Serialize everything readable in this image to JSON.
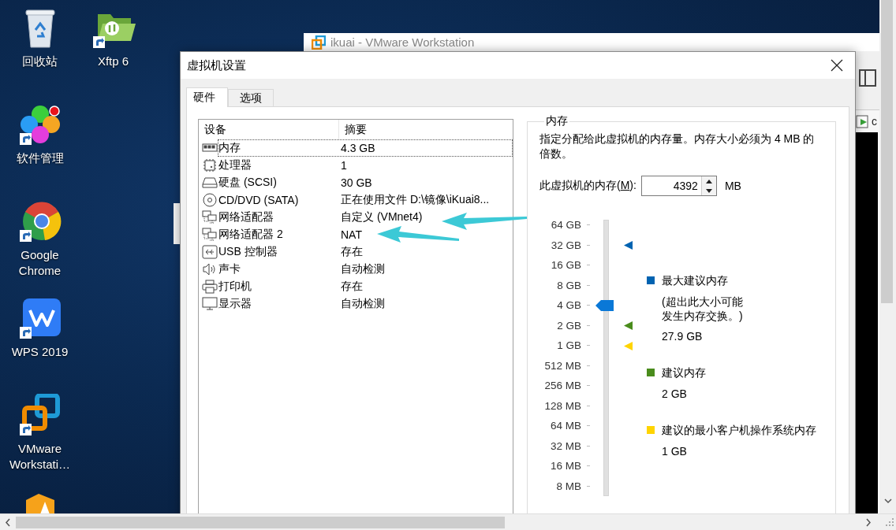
{
  "desktop_icons": [
    {
      "kind": "recycle-bin",
      "label": "回收站"
    },
    {
      "kind": "folder-app",
      "label": "Xftp 6"
    },
    {
      "kind": "flower-app",
      "label": "软件管理"
    },
    {
      "kind": "browser",
      "label": "Google Chrome"
    },
    {
      "kind": "office",
      "label": "WPS 2019"
    },
    {
      "kind": "vm",
      "label": "VMware Workstati…"
    },
    {
      "kind": "partial-app"
    }
  ],
  "background_window": {
    "title": "ikuai - VMware Workstation",
    "tab_label": "c"
  },
  "dialog": {
    "title": "虚拟机设置",
    "tabs": [
      {
        "label": "硬件",
        "selected": true
      },
      {
        "label": "选项",
        "selected": false
      }
    ],
    "device_list": {
      "columns": [
        "设备",
        "摘要"
      ],
      "rows": [
        {
          "kind": "memory",
          "device": "内存",
          "summary": "4.3 GB",
          "selected": true
        },
        {
          "kind": "cpu",
          "device": "处理器",
          "summary": "1",
          "selected": false
        },
        {
          "kind": "disk",
          "device": "硬盘 (SCSI)",
          "summary": "30 GB",
          "selected": false
        },
        {
          "kind": "cdrom",
          "device": "CD/DVD (SATA)",
          "summary": "正在使用文件 D:\\镜像\\iKuai8...",
          "selected": false
        },
        {
          "kind": "network",
          "device": "网络适配器",
          "summary": "自定义 (VMnet4)",
          "selected": false
        },
        {
          "kind": "network",
          "device": "网络适配器 2",
          "summary": "NAT",
          "selected": false
        },
        {
          "kind": "usb",
          "device": "USB 控制器",
          "summary": "存在",
          "selected": false
        },
        {
          "kind": "sound",
          "device": "声卡",
          "summary": "自动检测",
          "selected": false
        },
        {
          "kind": "printer",
          "device": "打印机",
          "summary": "存在",
          "selected": false
        },
        {
          "kind": "display",
          "device": "显示器",
          "summary": "自动检测",
          "selected": false
        }
      ]
    },
    "memory": {
      "title": "内存",
      "description": "指定分配给此虚拟机的内存量。内存大小必须为 4 MB 的倍数。",
      "field_label_before": "此虚拟机的内存(",
      "access_key": "M",
      "field_label_after": "):",
      "value": "4392",
      "unit": "MB",
      "scale": [
        {
          "label": "64 GB",
          "selected": false
        },
        {
          "label": "32 GB",
          "selected": false,
          "color": "#0063b1"
        },
        {
          "label": "16 GB",
          "selected": false
        },
        {
          "label": "8 GB",
          "selected": false
        },
        {
          "label": "4 GB",
          "selected": true
        },
        {
          "label": "2 GB",
          "selected": false,
          "color": "#4a8c1c"
        },
        {
          "label": "1 GB",
          "selected": false,
          "color": "#ffd400"
        },
        {
          "label": "512 MB",
          "selected": false
        },
        {
          "label": "256 MB",
          "selected": false
        },
        {
          "label": "128 MB",
          "selected": false
        },
        {
          "label": "64 MB",
          "selected": false
        },
        {
          "label": "32 MB",
          "selected": false
        },
        {
          "label": "16 MB",
          "selected": false
        },
        {
          "label": "8 MB",
          "selected": false
        }
      ],
      "legend": [
        {
          "color": "#0063b1",
          "title": "最大建议内存",
          "note": "(超出此大小可能发生内存交换。)",
          "value": "27.9 GB"
        },
        {
          "color": "#4a8c1c",
          "title": "建议内存",
          "value": "2 GB"
        },
        {
          "color": "#ffd400",
          "title": "建议的最小客户机操作系统内存",
          "value": "1 GB"
        }
      ]
    }
  }
}
